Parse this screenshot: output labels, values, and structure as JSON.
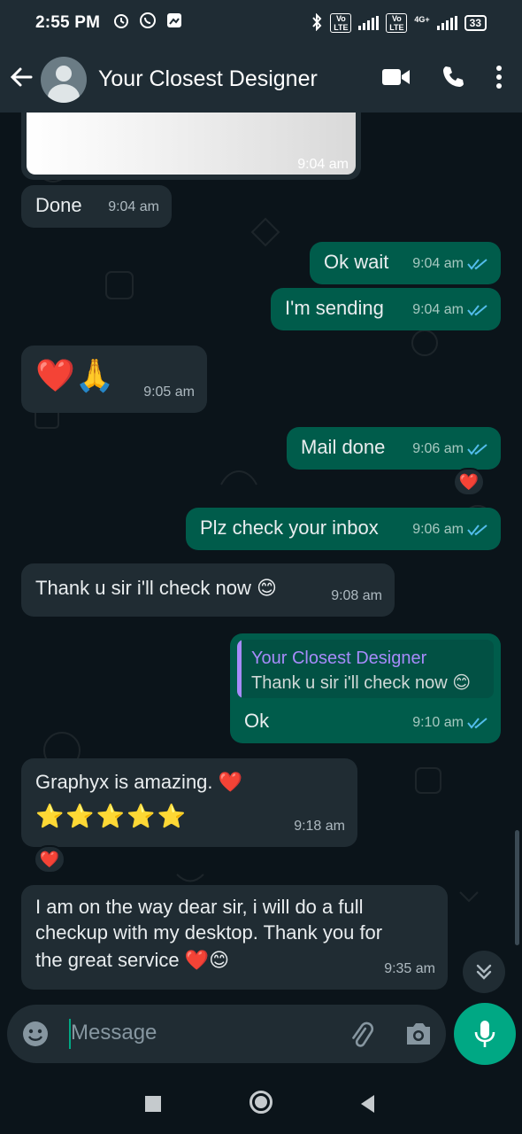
{
  "status_bar": {
    "time": "2:55 PM",
    "network1": "Vo LTE",
    "network2": "Vo LTE",
    "network_type": "4G+",
    "battery": "33",
    "left_icons": [
      "alarm-icon",
      "whatsapp-icon",
      "gallery-icon"
    ],
    "right_icons": [
      "bluetooth-icon",
      "signal-icon",
      "signal-icon",
      "battery-icon"
    ]
  },
  "header": {
    "contact_name": "Your Closest Designer",
    "icons": [
      "back-arrow-icon",
      "video-call-icon",
      "voice-call-icon",
      "more-vert-icon"
    ]
  },
  "messages": [
    {
      "dir": "in",
      "type": "image",
      "time": "9:04 am"
    },
    {
      "dir": "in",
      "text": "Done",
      "time": "9:04 am"
    },
    {
      "dir": "out",
      "text": "Ok wait",
      "time": "9:04 am",
      "status": "read"
    },
    {
      "dir": "out",
      "text": "I'm sending",
      "time": "9:04 am",
      "status": "read"
    },
    {
      "dir": "in",
      "text": "❤️🙏",
      "time": "9:05 am"
    },
    {
      "dir": "out",
      "text": "Mail done",
      "time": "9:06 am",
      "status": "read",
      "reaction": "❤️"
    },
    {
      "dir": "out",
      "text": "Plz check your inbox",
      "time": "9:06 am",
      "status": "read"
    },
    {
      "dir": "in",
      "text": "Thank u sir i'll check now 😊",
      "time": "9:08 am"
    },
    {
      "dir": "out",
      "text": "Ok",
      "time": "9:10 am",
      "status": "read",
      "quote": {
        "name": "Your Closest Designer",
        "text": "Thank u sir i'll check now 😊"
      }
    },
    {
      "dir": "in",
      "text_line1": "Graphyx is amazing. ❤️",
      "text_line2": "⭐⭐⭐⭐⭐",
      "time": "9:18 am",
      "reaction": "❤️"
    },
    {
      "dir": "in",
      "text_lines": [
        "I am on the way dear sir, i will do a full",
        "checkup with my desktop. Thank you for",
        "the great service ❤️😊"
      ],
      "time": "9:35 am"
    }
  ],
  "input": {
    "placeholder": "Message",
    "icons": [
      "emoji-icon",
      "attach-icon",
      "camera-icon",
      "mic-icon"
    ]
  },
  "colors": {
    "background": "#0b141a",
    "header": "#1f2c34",
    "incoming": "#202c33",
    "outgoing": "#005c4b",
    "accent": "#00a884",
    "read_tick": "#53bdeb",
    "quote_name": "#a78bfa"
  }
}
